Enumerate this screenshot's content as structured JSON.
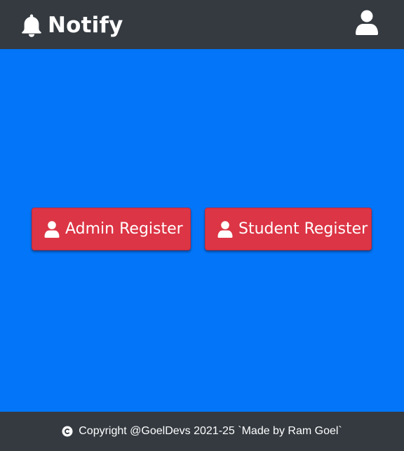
{
  "navbar": {
    "brand_icon": "bell-icon",
    "brand_label": "Notify",
    "profile_icon": "user-icon"
  },
  "main": {
    "background": "#0275f8",
    "buttons": [
      {
        "icon": "user-icon",
        "label": "Admin Register",
        "color": "#dc3545"
      },
      {
        "icon": "user-icon",
        "label": "Student Register",
        "color": "#dc3545"
      }
    ]
  },
  "footer": {
    "icon": "copyright-icon",
    "text": "Copyright @GoelDevs 2021-25 `Made by Ram Goel`"
  },
  "colors": {
    "navbar": "#343a40",
    "primary": "#0275f8",
    "danger": "#dc3545"
  }
}
